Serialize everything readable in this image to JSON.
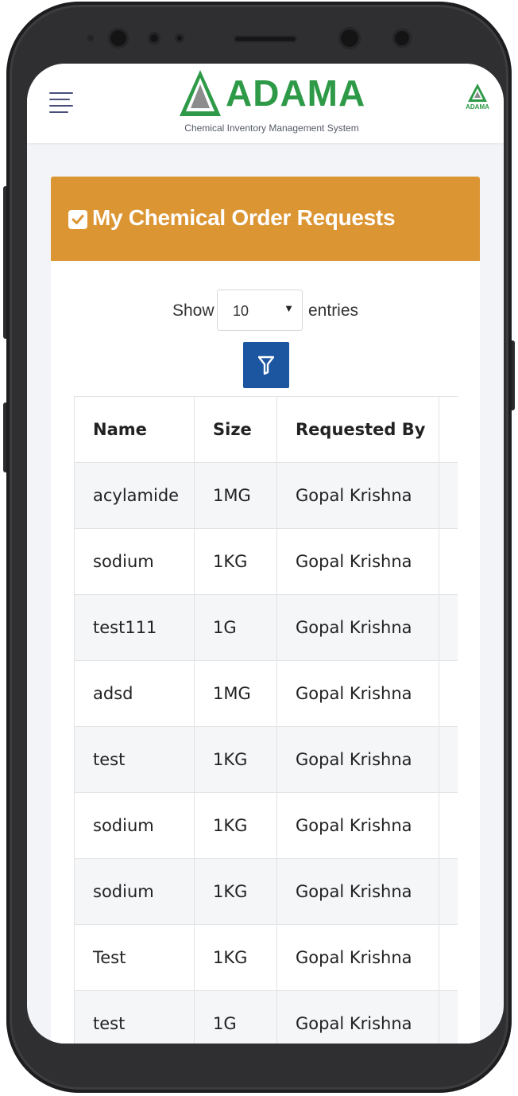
{
  "brand": {
    "title": "ADAMA",
    "subtitle": "Chemical Inventory Management System",
    "mini_logo_text": "ADAMA",
    "color": "#2e9a48"
  },
  "card": {
    "title": "My Chemical Order Requests",
    "header_color": "#dc9533"
  },
  "controls": {
    "show_label": "Show",
    "entries_value": "10",
    "entries_label": "entries",
    "filter_icon": "filter-icon",
    "filter_color": "#1c55a0"
  },
  "table": {
    "headers": [
      "Name",
      "Size",
      "Requested By",
      ""
    ],
    "rows": [
      {
        "name": "acylamide",
        "size": "1MG",
        "requested_by": "Gopal Krishna"
      },
      {
        "name": "sodium",
        "size": "1KG",
        "requested_by": "Gopal Krishna"
      },
      {
        "name": "test111",
        "size": "1G",
        "requested_by": "Gopal Krishna"
      },
      {
        "name": "adsd",
        "size": "1MG",
        "requested_by": "Gopal Krishna"
      },
      {
        "name": "test",
        "size": "1KG",
        "requested_by": "Gopal Krishna"
      },
      {
        "name": "sodium",
        "size": "1KG",
        "requested_by": "Gopal Krishna"
      },
      {
        "name": "sodium",
        "size": "1KG",
        "requested_by": "Gopal Krishna"
      },
      {
        "name": "Test",
        "size": "1KG",
        "requested_by": "Gopal Krishna"
      },
      {
        "name": "test",
        "size": "1G",
        "requested_by": "Gopal Krishna"
      }
    ]
  }
}
